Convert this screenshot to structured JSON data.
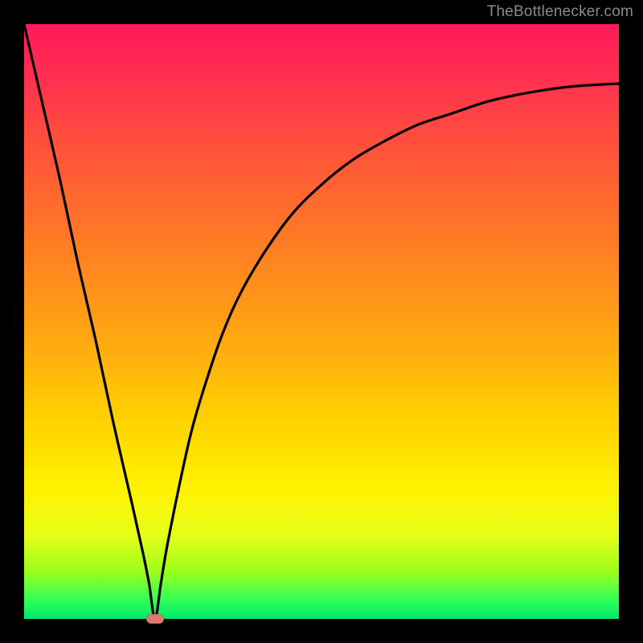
{
  "watermark": "TheBottlenecker.com",
  "colors": {
    "curve": "#000000",
    "marker": "#d97a6a",
    "gradient_stops": [
      "#ff1a5b",
      "#ff2d52",
      "#ff4a3f",
      "#ff6a2e",
      "#ff8a1e",
      "#ffab10",
      "#ffd000",
      "#fff200",
      "#e6ff1a",
      "#9cff1a",
      "#2cff5a",
      "#00e86b"
    ]
  },
  "chart_data": {
    "type": "line",
    "title": "",
    "xlabel": "",
    "ylabel": "",
    "xlim": [
      0,
      100
    ],
    "ylim": [
      0,
      100
    ],
    "x_min_at": 22,
    "marker": {
      "x": 22,
      "y": 0
    },
    "series": [
      {
        "name": "bottleneck-curve",
        "x": [
          0,
          3,
          6,
          9,
          12,
          15,
          18,
          20,
          21,
          22,
          23,
          24,
          26,
          28,
          30,
          33,
          36,
          40,
          45,
          50,
          55,
          60,
          66,
          72,
          78,
          85,
          92,
          100
        ],
        "y": [
          100,
          87,
          74,
          60,
          47,
          33,
          20,
          11,
          6,
          0,
          6,
          12,
          22,
          31,
          38,
          47,
          54,
          61,
          68,
          73,
          77,
          80,
          83,
          85,
          87,
          88.5,
          89.5,
          90
        ]
      }
    ]
  }
}
